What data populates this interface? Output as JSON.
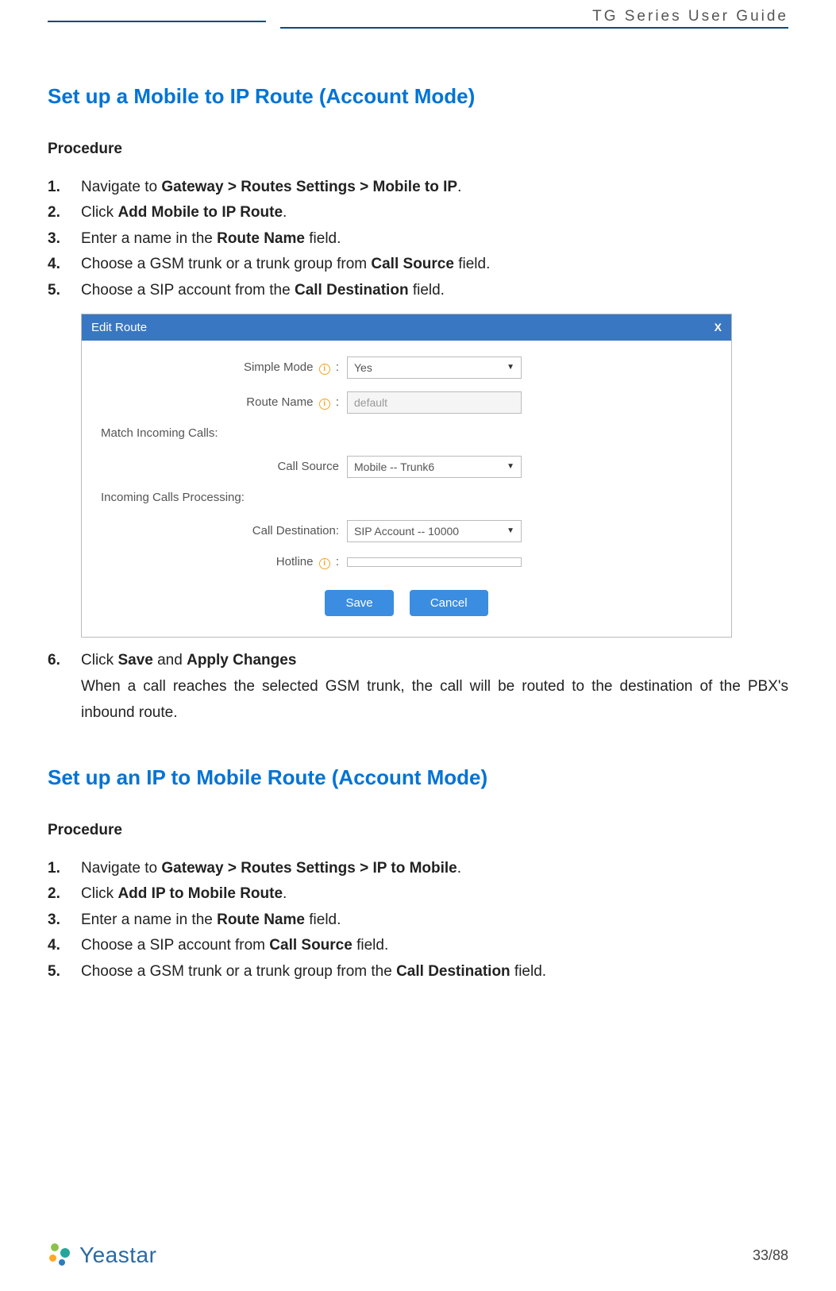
{
  "header": {
    "doc_title": "TG  Series  User  Guide"
  },
  "section1": {
    "title": "Set up a Mobile to IP Route (Account Mode)",
    "procedure_label": "Procedure",
    "steps": {
      "s1_pre": "Navigate to ",
      "s1_b": "Gateway > Routes Settings > Mobile to IP",
      "s1_post": ".",
      "s2_pre": "Click ",
      "s2_b": "Add Mobile to IP Route",
      "s2_post": ".",
      "s3_pre": "Enter a name in the ",
      "s3_b": "Route Name",
      "s3_post": " field.",
      "s4_pre": "Choose a GSM trunk or a trunk group from ",
      "s4_b": "Call Source",
      "s4_post": " field.",
      "s5_pre": "Choose a SIP account from the ",
      "s5_b": "Call Destination",
      "s5_post": " field.",
      "s6_pre": "Click ",
      "s6_b1": "Save",
      "s6_mid": " and ",
      "s6_b2": "Apply Changes",
      "s6_note": "When a call reaches the selected GSM trunk, the call will be routed to the destination of the PBX's inbound route."
    }
  },
  "dialog": {
    "title": "Edit Route",
    "close": "X",
    "simple_mode_label": "Simple Mode",
    "simple_mode_value": "Yes",
    "route_name_label": "Route Name",
    "route_name_value": "default",
    "match_section": "Match Incoming Calls:",
    "call_source_label": "Call Source",
    "call_source_value": "Mobile -- Trunk6",
    "processing_section": "Incoming Calls Processing:",
    "call_dest_label": "Call Destination:",
    "call_dest_value": "SIP Account -- 10000",
    "hotline_label": "Hotline",
    "hotline_value": "",
    "save_btn": "Save",
    "cancel_btn": "Cancel",
    "colon": " :"
  },
  "section2": {
    "title": "Set up an IP to Mobile Route (Account Mode)",
    "procedure_label": "Procedure",
    "steps": {
      "s1_pre": "Navigate to ",
      "s1_b": "Gateway > Routes Settings > IP to Mobile",
      "s1_post": ".",
      "s2_pre": "Click ",
      "s2_b": "Add IP to Mobile Route",
      "s2_post": ".",
      "s3_pre": "Enter a name in the ",
      "s3_b": "Route Name",
      "s3_post": " field.",
      "s4_pre": "Choose a SIP account from ",
      "s4_b": "Call Source",
      "s4_post": " field.",
      "s5_pre": "Choose a GSM trunk or a trunk group from the ",
      "s5_b": "Call Destination",
      "s5_post": " field."
    }
  },
  "footer": {
    "brand": "Yeastar",
    "page": "33/88"
  }
}
